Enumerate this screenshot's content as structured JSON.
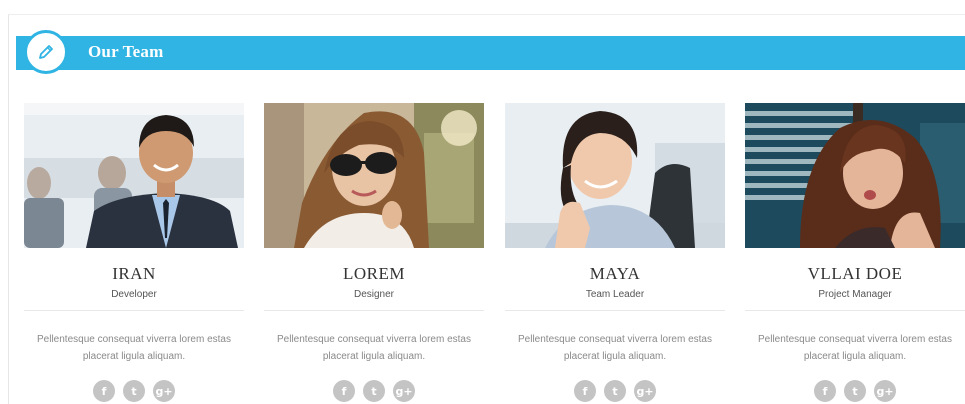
{
  "section": {
    "title": "Our Team",
    "icon": "pencil-icon",
    "accent_color": "#2fb4e3"
  },
  "members": [
    {
      "name": "IRAN",
      "role": "Developer",
      "description": "Pellentesque consequat viverra lorem estas placerat ligula aliquam.",
      "photo": "man-in-suit-photo"
    },
    {
      "name": "LOREM",
      "role": "Designer",
      "description": "Pellentesque consequat viverra lorem estas placerat ligula aliquam.",
      "photo": "woman-sunglasses-photo"
    },
    {
      "name": "MAYA",
      "role": "Team Leader",
      "description": "Pellentesque consequat viverra lorem estas placerat ligula aliquam.",
      "photo": "smiling-woman-office-photo"
    },
    {
      "name": "VLLAI DOE",
      "role": "Project Manager",
      "description": "Pellentesque consequat viverra lorem estas placerat ligula aliquam.",
      "photo": "woman-by-window-photo"
    }
  ],
  "social_icons": [
    {
      "name": "facebook-icon",
      "glyph": "f"
    },
    {
      "name": "twitter-icon",
      "glyph": "t"
    },
    {
      "name": "google-plus-icon",
      "glyph": "g+"
    }
  ]
}
